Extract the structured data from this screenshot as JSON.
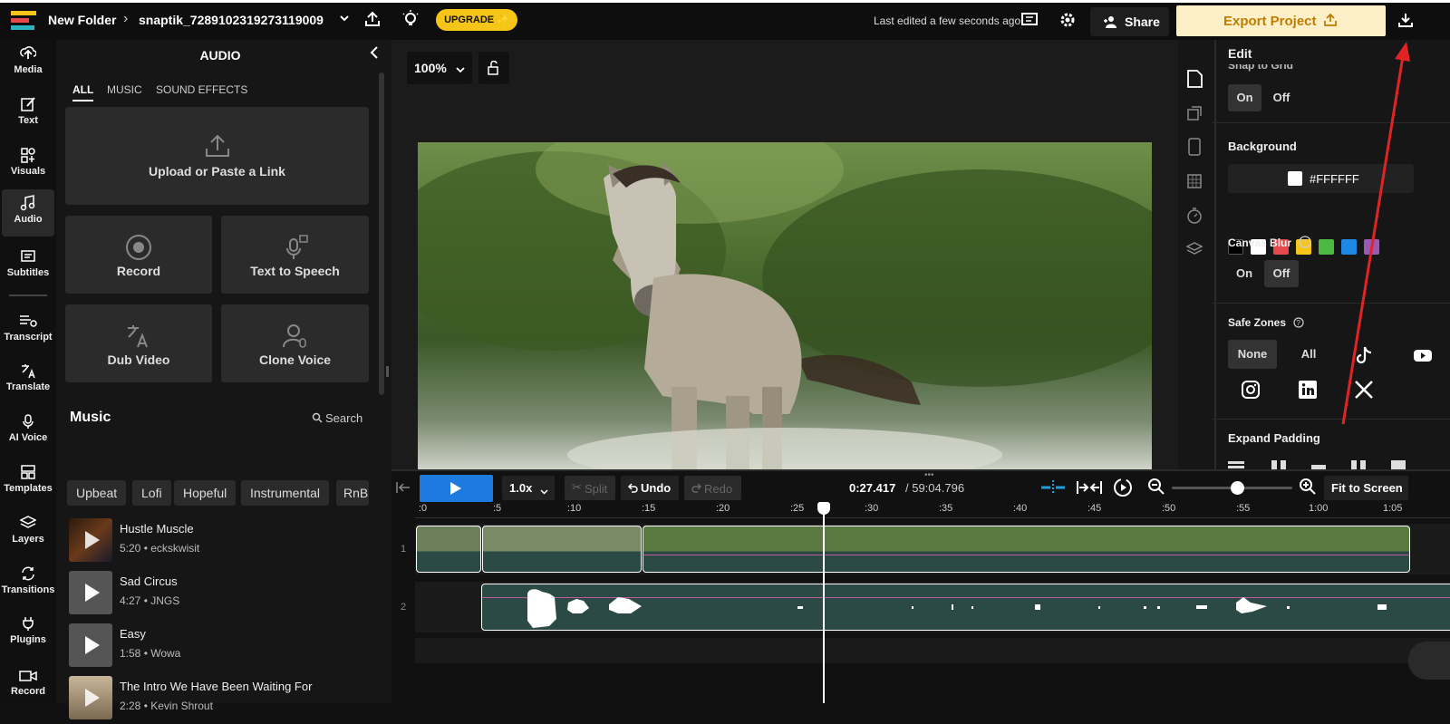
{
  "topbar": {
    "folder": "New Folder",
    "project": "snaptik_7289102319273119009",
    "upgrade": "UPGRADE ✨",
    "last_edited": "Last edited a few seconds ago",
    "share": "Share",
    "export": "Export Project"
  },
  "nav": [
    {
      "label": "Media",
      "icon": "upload-cloud-icon"
    },
    {
      "label": "Text",
      "icon": "pencil-icon"
    },
    {
      "label": "Visuals",
      "icon": "shapes-icon"
    },
    {
      "label": "Audio",
      "icon": "music-note-icon"
    },
    {
      "label": "Subtitles",
      "icon": "subtitles-icon"
    },
    {
      "label": "Transcript",
      "icon": "transcript-icon"
    },
    {
      "label": "Translate",
      "icon": "translate-icon"
    },
    {
      "label": "AI Voice",
      "icon": "ai-voice-icon"
    },
    {
      "label": "Templates",
      "icon": "templates-icon"
    },
    {
      "label": "Layers",
      "icon": "layers-icon"
    },
    {
      "label": "Transitions",
      "icon": "transitions-icon"
    },
    {
      "label": "Plugins",
      "icon": "plug-icon"
    },
    {
      "label": "Record",
      "icon": "camera-icon"
    }
  ],
  "panel": {
    "title": "AUDIO",
    "tabs": [
      "ALL",
      "MUSIC",
      "SOUND EFFECTS"
    ],
    "upload": "Upload or Paste a Link",
    "record": "Record",
    "tts": "Text to Speech",
    "dub": "Dub Video",
    "clone": "Clone Voice",
    "music_heading": "Music",
    "search": "Search",
    "chips": [
      "Upbeat",
      "Lofi",
      "Hopeful",
      "Instrumental",
      "RnB"
    ],
    "tracks": [
      {
        "title": "Hustle Muscle",
        "sub": "5:20 • eckskwisit"
      },
      {
        "title": "Sad Circus",
        "sub": "4:27 • JNGS"
      },
      {
        "title": "Easy",
        "sub": "1:58 • Wowa"
      },
      {
        "title": "The Intro We Have Been Waiting For",
        "sub": "2:28 • Kevin Shrout"
      }
    ]
  },
  "stage": {
    "zoom": "100%"
  },
  "props": {
    "edit": "Edit",
    "snap": "Snap to Grid",
    "on": "On",
    "off": "Off",
    "background": "Background",
    "bg_hex": "#FFFFFF",
    "swatches": [
      "#000000",
      "#FFFFFF",
      "#E5484D",
      "#F5C518",
      "#4CB844",
      "#1E88E5",
      "#9B59B6"
    ],
    "blur": "Canvas Blur",
    "safe": "Safe Zones",
    "none": "None",
    "all": "All",
    "expand": "Expand Padding"
  },
  "timeline": {
    "speed": "1.0x",
    "split": "Split",
    "undo": "Undo",
    "redo": "Redo",
    "current": "0:27.417",
    "total": "/ 59:04.796",
    "fit": "Fit to Screen",
    "ticks": [
      ":0",
      ":5",
      ":10",
      ":15",
      ":20",
      ":25",
      ":30",
      ":35",
      ":40",
      ":45",
      ":50",
      ":55",
      "1:00",
      "1:05"
    ],
    "row1": "1",
    "row2": "2"
  },
  "colors": {
    "accent": "#1f7ae0",
    "upgrade": "#f5c518",
    "export_bg": "#fdf0c8",
    "export_text": "#c07c00",
    "clip": "#2b4a45",
    "arrow": "#e02424"
  }
}
